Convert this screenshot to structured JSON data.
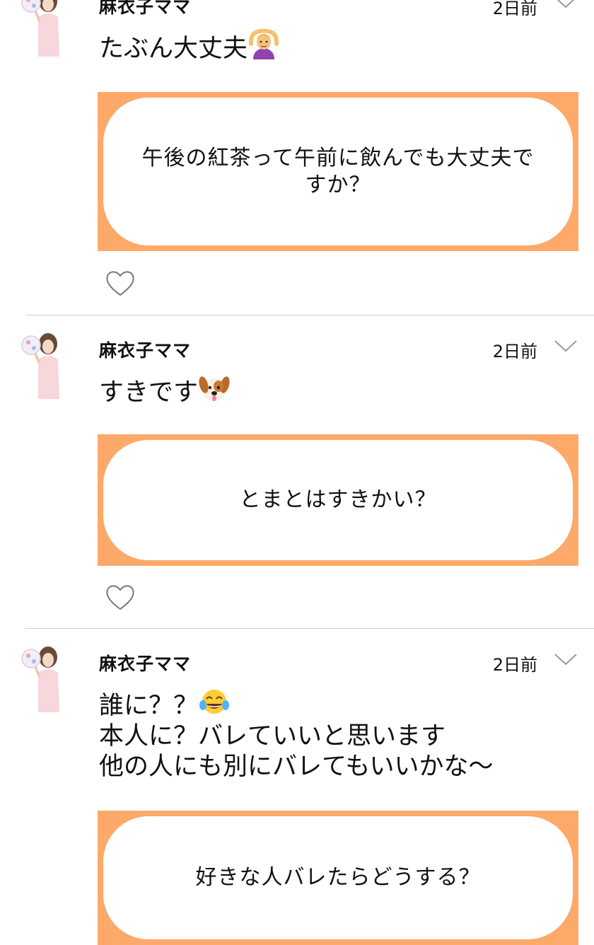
{
  "colors": {
    "card_border": "#fda96a",
    "divider": "#cfcfcf",
    "text": "#111111"
  },
  "posts": [
    {
      "user": "麻衣子ママ",
      "time": "2日前",
      "text": "たぶん大丈夫",
      "emoji": "person-gesturing-ok-emoji",
      "question": "午後の紅茶って午前に飲んでも大丈夫ですか？"
    },
    {
      "user": "麻衣子ママ",
      "time": "2日前",
      "text": "すきです",
      "emoji": "dog-face-emoji",
      "question": "とまとはすきかい？"
    },
    {
      "user": "麻衣子ママ",
      "time": "2日前",
      "text_lines": [
        "誰に？？",
        "本人に？バレていいと思います",
        "他の人にも別にバレてもいいかな〜"
      ],
      "emoji": "tears-of-joy-emoji",
      "question": "好きな人バレたらどうする？"
    }
  ],
  "icons": {
    "menu": "chevron-down-icon",
    "like": "heart-outline-icon",
    "avatar": "user-avatar-photo"
  }
}
